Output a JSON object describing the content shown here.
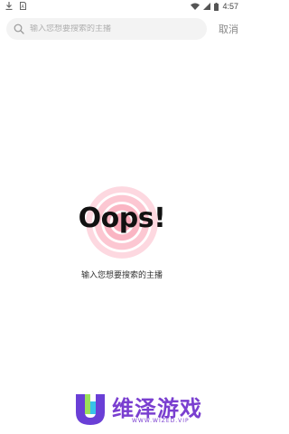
{
  "status_bar": {
    "time": "4:57",
    "icons": [
      "download-icon",
      "sim-card-icon",
      "wifi-icon",
      "cellular-signal-icon",
      "battery-icon"
    ]
  },
  "search": {
    "placeholder": "输入您想要搜索的主播",
    "value": "",
    "cancel_label": "取消",
    "icon": "search-icon"
  },
  "empty_state": {
    "title": "Oops!",
    "message": "输入您想要搜索的主播",
    "accent_color": "#f8a8b8"
  },
  "watermark": {
    "title": "维泽游戏",
    "subtitle": "WWW.WIZED.VIP",
    "color": "#7a3fd0"
  }
}
